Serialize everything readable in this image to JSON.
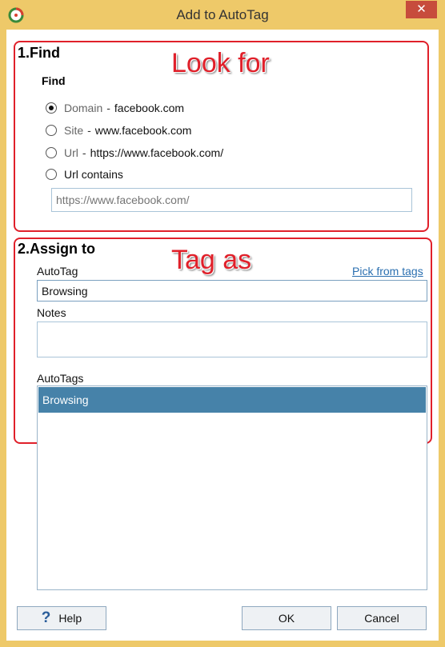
{
  "window": {
    "title": "Add to AutoTag",
    "close_glyph": "✕",
    "app_icon": "autotag-app-icon"
  },
  "annotations": {
    "find_callout": "Look for",
    "assign_callout": "Tag as"
  },
  "find_section": {
    "title": "1.Find",
    "group_label": "Find",
    "options": [
      {
        "label": "Domain",
        "separator": "-",
        "value": "facebook.com",
        "checked": true
      },
      {
        "label": "Site",
        "separator": "-",
        "value": "www.facebook.com",
        "checked": false
      },
      {
        "label": "Url",
        "separator": "-",
        "value": "https://www.facebook.com/",
        "checked": false
      },
      {
        "label": "Url contains",
        "separator": "",
        "value": "",
        "checked": false
      }
    ],
    "url_contains_placeholder": "https://www.facebook.com/"
  },
  "assign_section": {
    "title": "2.Assign to",
    "autotag_label": "AutoTag",
    "pick_link": "Pick from tags",
    "autotag_value": "Browsing",
    "notes_label": "Notes",
    "notes_value": "",
    "autotags_label": "AutoTags",
    "autotags_items": [
      "Browsing"
    ]
  },
  "buttons": {
    "help": "Help",
    "help_icon": "?",
    "ok": "OK",
    "cancel": "Cancel"
  },
  "colors": {
    "titlebar": "#eec969",
    "annotation": "#e0202a",
    "selection": "#4682a9",
    "close": "#c74c3c"
  }
}
